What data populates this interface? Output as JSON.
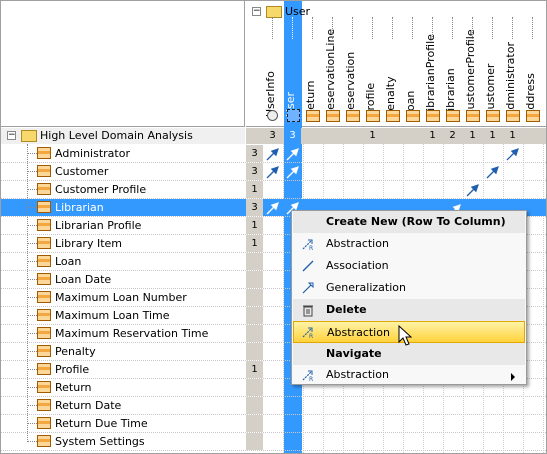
{
  "column_root_label": "User",
  "columns": [
    "UserInfo",
    "User",
    "Return",
    "ReservationLine",
    "Reservation",
    "Profile",
    "Penalty",
    "Loan",
    "LibrarianProfile",
    "Librarian",
    "CustomerProfile",
    "Customer",
    "Administrator",
    "Address"
  ],
  "column_counts": [
    "3",
    "3",
    "",
    "",
    "",
    "1",
    "",
    "",
    "1",
    "2",
    "1",
    "1",
    "1",
    ""
  ],
  "tree_root": "High Level Domain Analysis",
  "rows": [
    {
      "label": "Administrator",
      "count": "3"
    },
    {
      "label": "Customer",
      "count": "3"
    },
    {
      "label": "Customer Profile",
      "count": "1"
    },
    {
      "label": "Librarian",
      "count": "3"
    },
    {
      "label": "Librarian Profile",
      "count": "1"
    },
    {
      "label": "Library Item",
      "count": "1"
    },
    {
      "label": "Loan",
      "count": ""
    },
    {
      "label": "Loan Date",
      "count": ""
    },
    {
      "label": "Maximum Loan Number",
      "count": ""
    },
    {
      "label": "Maximum Loan Time",
      "count": ""
    },
    {
      "label": "Maximum Reservation Time",
      "count": ""
    },
    {
      "label": "Penalty",
      "count": ""
    },
    {
      "label": "Profile",
      "count": "1"
    },
    {
      "label": "Return",
      "count": ""
    },
    {
      "label": "Return Date",
      "count": ""
    },
    {
      "label": "Return Due Time",
      "count": ""
    },
    {
      "label": "System Settings",
      "count": ""
    }
  ],
  "menu": {
    "create_new_header": "Create New (Row To Column)",
    "abstraction": "Abstraction",
    "association": "Association",
    "generalization": "Generalization",
    "delete_header": "Delete",
    "delete_abstraction": "Abstraction",
    "navigate_header": "Navigate",
    "navigate_abstraction": "Abstraction"
  }
}
